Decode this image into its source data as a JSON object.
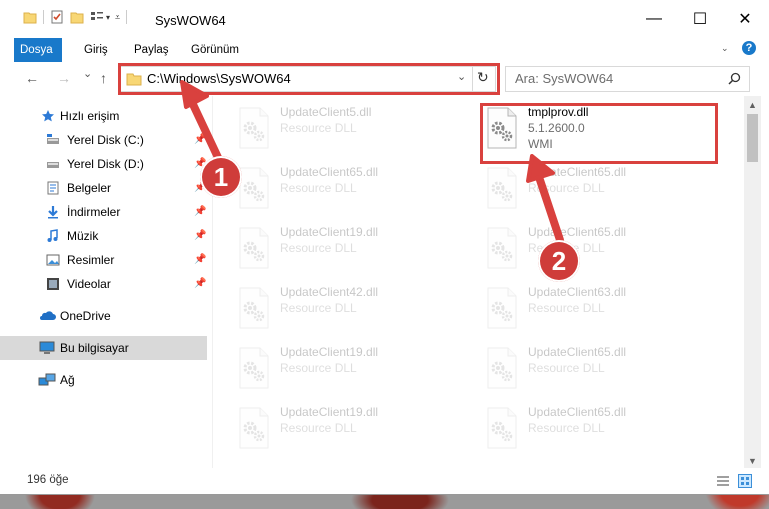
{
  "window": {
    "title": "SysWOW64",
    "minimize_glyph": "—",
    "maximize_glyph": "☐",
    "close_glyph": "✕"
  },
  "ribbon": {
    "tabs": [
      "Dosya",
      "Giriş",
      "Paylaş",
      "Görünüm"
    ],
    "help_glyph": "?"
  },
  "nav": {
    "back_glyph": "←",
    "forward_glyph": "→",
    "recent_glyph": "⌄",
    "up_glyph": "↑",
    "address": "C:\\Windows\\SysWOW64",
    "search_placeholder": "Ara: SysWOW64"
  },
  "sidebar": {
    "items": [
      {
        "label": "Hızlı erişim",
        "icon": "star-icon"
      },
      {
        "label": "Yerel Disk (C:)",
        "icon": "drive-icon"
      },
      {
        "label": "Yerel Disk (D:)",
        "icon": "drive-icon"
      },
      {
        "label": "Belgeler",
        "icon": "documents-icon"
      },
      {
        "label": "İndirmeler",
        "icon": "download-icon"
      },
      {
        "label": "Müzik",
        "icon": "music-icon"
      },
      {
        "label": "Resimler",
        "icon": "pictures-icon"
      },
      {
        "label": "Videolar",
        "icon": "video-icon"
      },
      {
        "label": "OneDrive",
        "icon": "cloud-icon"
      },
      {
        "label": "Bu bilgisayar",
        "icon": "computer-icon"
      },
      {
        "label": "Ağ",
        "icon": "network-icon"
      }
    ]
  },
  "files": {
    "left_column": [
      {
        "name": "UpdateClient5.dll",
        "type": "Resource DLL"
      },
      {
        "name": "UpdateClient65.dll",
        "type": "Resource DLL"
      },
      {
        "name": "UpdateClient19.dll",
        "type": "Resource DLL"
      },
      {
        "name": "UpdateClient42.dll",
        "type": "Resource DLL"
      },
      {
        "name": "UpdateClient19.dll",
        "type": "Resource DLL"
      },
      {
        "name": "UpdateClient19.dll",
        "type": "Resource DLL"
      }
    ],
    "right_column": [
      {
        "name": "tmplprov.dll",
        "version": "5.1.2600.0",
        "type": "WMI"
      },
      {
        "name": "UpdateClient65.dll",
        "type": "Resource DLL"
      },
      {
        "name": "UpdateClient65.dll",
        "type": "Resource DLL"
      },
      {
        "name": "UpdateClient63.dll",
        "type": "Resource DLL"
      },
      {
        "name": "UpdateClient65.dll",
        "type": "Resource DLL"
      },
      {
        "name": "UpdateClient65.dll",
        "type": "Resource DLL"
      }
    ]
  },
  "status": {
    "count": "196 öğe"
  },
  "annotations": {
    "badge_1": "1",
    "badge_2": "2",
    "color": "#d9413e"
  }
}
